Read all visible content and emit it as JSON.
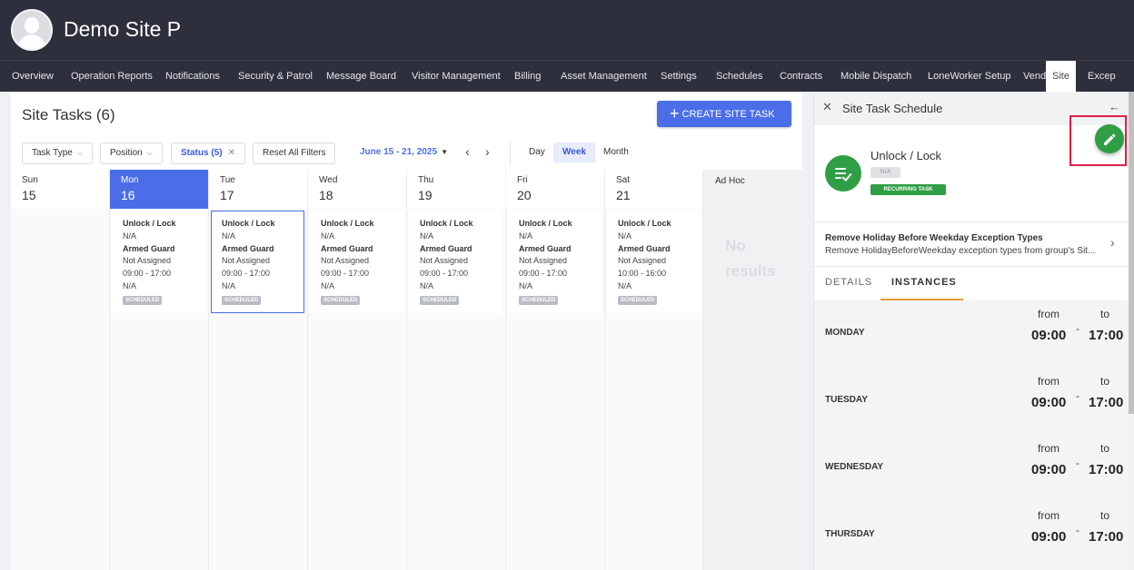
{
  "header": {
    "site_name": "Demo Site P"
  },
  "nav": {
    "tabs": [
      "Overview",
      "Operation Reports",
      "Notifications",
      "Security & Patrol",
      "Message Board",
      "Visitor Management",
      "Billing",
      "Asset Management",
      "Settings",
      "Schedules",
      "Contracts",
      "Mobile Dispatch",
      "LoneWorker Setup",
      "Vend",
      "Site",
      "Excep"
    ],
    "active": "Site"
  },
  "main": {
    "title": "Site Tasks (6)",
    "create_button": "CREATE SITE TASK",
    "filters": {
      "task_type": "Task Type",
      "position": "Position",
      "status": "Status (5)",
      "reset": "Reset All Filters"
    },
    "date_range": "June 15 - 21, 2025",
    "views": [
      "Day",
      "Week",
      "Month"
    ],
    "active_view": "Week",
    "days": [
      {
        "name": "Sun",
        "date": "15"
      },
      {
        "name": "Mon",
        "date": "16"
      },
      {
        "name": "Tue",
        "date": "17"
      },
      {
        "name": "Wed",
        "date": "18"
      },
      {
        "name": "Thu",
        "date": "19"
      },
      {
        "name": "Fri",
        "date": "20"
      },
      {
        "name": "Sat",
        "date": "21"
      }
    ],
    "adhoc_label": "Ad Hoc",
    "no_results": "No results",
    "tasks": [
      {
        "title": "Unlock / Lock",
        "na1": "N/A",
        "position": "Armed Guard",
        "assignee": "Not Assigned",
        "time": "09:00 - 17:00",
        "na2": "N/A",
        "status": "SCHEDULED"
      },
      {
        "title": "Unlock / Lock",
        "na1": "N/A",
        "position": "Armed Guard",
        "assignee": "Not Assigned",
        "time": "09:00 - 17:00",
        "na2": "N/A",
        "status": "SCHEDULED"
      },
      {
        "title": "Unlock / Lock",
        "na1": "N/A",
        "position": "Armed Guard",
        "assignee": "Not Assigned",
        "time": "09:00 - 17:00",
        "na2": "N/A",
        "status": "SCHEDULED"
      },
      {
        "title": "Unlock / Lock",
        "na1": "N/A",
        "position": "Armed Guard",
        "assignee": "Not Assigned",
        "time": "09:00 - 17:00",
        "na2": "N/A",
        "status": "SCHEDULED"
      },
      {
        "title": "Unlock / Lock",
        "na1": "N/A",
        "position": "Armed Guard",
        "assignee": "Not Assigned",
        "time": "09:00 - 17:00",
        "na2": "N/A",
        "status": "SCHEDULED"
      },
      {
        "title": "Unlock / Lock",
        "na1": "N/A",
        "position": "Armed Guard",
        "assignee": "Not Assigned",
        "time": "10:00 - 16:00",
        "na2": "N/A",
        "status": "SCHEDULED"
      }
    ]
  },
  "panel": {
    "title": "Site Task Schedule",
    "task_name": "Unlock / Lock",
    "na_chip": "N/A",
    "recurring_chip": "RECURRING TASK",
    "exception_title": "Remove Holiday Before Weekday Exception Types",
    "exception_sub": "Remove HolidayBeforeWeekday exception types from group's Sit...",
    "tabs": [
      "DETAILS",
      "INSTANCES"
    ],
    "active_tab": "INSTANCES",
    "from_label": "from",
    "to_label": "to",
    "instances": [
      {
        "day": "MONDAY",
        "from": "09:00",
        "to": "17:00"
      },
      {
        "day": "TUESDAY",
        "from": "09:00",
        "to": "17:00"
      },
      {
        "day": "WEDNESDAY",
        "from": "09:00",
        "to": "17:00"
      },
      {
        "day": "THURSDAY",
        "from": "09:00",
        "to": "17:00"
      }
    ]
  },
  "colors": {
    "header_bg": "#2d2f3d",
    "accent": "#4b6ee8",
    "success": "#2f9e44",
    "highlight": "#e11d48"
  }
}
